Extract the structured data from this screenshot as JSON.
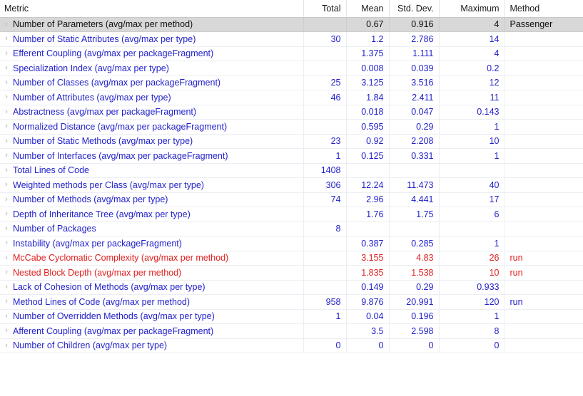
{
  "table": {
    "columns": [
      {
        "key": "metric",
        "label": "Metric",
        "align": "left"
      },
      {
        "key": "total",
        "label": "Total",
        "align": "right"
      },
      {
        "key": "mean",
        "label": "Mean",
        "align": "right"
      },
      {
        "key": "stddev",
        "label": "Std. Dev.",
        "align": "right"
      },
      {
        "key": "maximum",
        "label": "Maximum",
        "align": "right"
      },
      {
        "key": "method",
        "label": "Method",
        "align": "left"
      }
    ],
    "twisty_icon": "›",
    "colors": {
      "normal_row_text": "#2222cc",
      "warning_row_text": "#e02020",
      "selected_row_bg": "#d8d8d8",
      "selected_row_text": "#101010",
      "header_text": "#1a1a1a",
      "grid_line": "#eceef3"
    },
    "rows": [
      {
        "metric": "Number of Parameters (avg/max per method)",
        "total": "",
        "mean": "0.67",
        "stddev": "0.916",
        "maximum": "4",
        "method": "Passenger",
        "state": "selected"
      },
      {
        "metric": "Number of Static Attributes (avg/max per type)",
        "total": "30",
        "mean": "1.2",
        "stddev": "2.786",
        "maximum": "14",
        "method": "",
        "state": "normal"
      },
      {
        "metric": "Efferent Coupling (avg/max per packageFragment)",
        "total": "",
        "mean": "1.375",
        "stddev": "1.111",
        "maximum": "4",
        "method": "",
        "state": "normal"
      },
      {
        "metric": "Specialization Index (avg/max per type)",
        "total": "",
        "mean": "0.008",
        "stddev": "0.039",
        "maximum": "0.2",
        "method": "",
        "state": "normal"
      },
      {
        "metric": "Number of Classes (avg/max per packageFragment)",
        "total": "25",
        "mean": "3.125",
        "stddev": "3.516",
        "maximum": "12",
        "method": "",
        "state": "normal"
      },
      {
        "metric": "Number of Attributes (avg/max per type)",
        "total": "46",
        "mean": "1.84",
        "stddev": "2.411",
        "maximum": "11",
        "method": "",
        "state": "normal"
      },
      {
        "metric": "Abstractness (avg/max per packageFragment)",
        "total": "",
        "mean": "0.018",
        "stddev": "0.047",
        "maximum": "0.143",
        "method": "",
        "state": "normal"
      },
      {
        "metric": "Normalized Distance (avg/max per packageFragment)",
        "total": "",
        "mean": "0.595",
        "stddev": "0.29",
        "maximum": "1",
        "method": "",
        "state": "normal"
      },
      {
        "metric": "Number of Static Methods (avg/max per type)",
        "total": "23",
        "mean": "0.92",
        "stddev": "2.208",
        "maximum": "10",
        "method": "",
        "state": "normal"
      },
      {
        "metric": "Number of Interfaces (avg/max per packageFragment)",
        "total": "1",
        "mean": "0.125",
        "stddev": "0.331",
        "maximum": "1",
        "method": "",
        "state": "normal"
      },
      {
        "metric": "Total Lines of Code",
        "total": "1408",
        "mean": "",
        "stddev": "",
        "maximum": "",
        "method": "",
        "state": "normal"
      },
      {
        "metric": "Weighted methods per Class (avg/max per type)",
        "total": "306",
        "mean": "12.24",
        "stddev": "11.473",
        "maximum": "40",
        "method": "",
        "state": "normal"
      },
      {
        "metric": "Number of Methods (avg/max per type)",
        "total": "74",
        "mean": "2.96",
        "stddev": "4.441",
        "maximum": "17",
        "method": "",
        "state": "normal"
      },
      {
        "metric": "Depth of Inheritance Tree (avg/max per type)",
        "total": "",
        "mean": "1.76",
        "stddev": "1.75",
        "maximum": "6",
        "method": "",
        "state": "normal"
      },
      {
        "metric": "Number of Packages",
        "total": "8",
        "mean": "",
        "stddev": "",
        "maximum": "",
        "method": "",
        "state": "normal"
      },
      {
        "metric": "Instability (avg/max per packageFragment)",
        "total": "",
        "mean": "0.387",
        "stddev": "0.285",
        "maximum": "1",
        "method": "",
        "state": "normal"
      },
      {
        "metric": "McCabe Cyclomatic Complexity (avg/max per method)",
        "total": "",
        "mean": "3.155",
        "stddev": "4.83",
        "maximum": "26",
        "method": "run",
        "state": "warning"
      },
      {
        "metric": "Nested Block Depth (avg/max per method)",
        "total": "",
        "mean": "1.835",
        "stddev": "1.538",
        "maximum": "10",
        "method": "run",
        "state": "warning"
      },
      {
        "metric": "Lack of Cohesion of Methods (avg/max per type)",
        "total": "",
        "mean": "0.149",
        "stddev": "0.29",
        "maximum": "0.933",
        "method": "",
        "state": "normal"
      },
      {
        "metric": "Method Lines of Code (avg/max per method)",
        "total": "958",
        "mean": "9.876",
        "stddev": "20.991",
        "maximum": "120",
        "method": "run",
        "state": "normal"
      },
      {
        "metric": "Number of Overridden Methods (avg/max per type)",
        "total": "1",
        "mean": "0.04",
        "stddev": "0.196",
        "maximum": "1",
        "method": "",
        "state": "normal"
      },
      {
        "metric": "Afferent Coupling (avg/max per packageFragment)",
        "total": "",
        "mean": "3.5",
        "stddev": "2.598",
        "maximum": "8",
        "method": "",
        "state": "normal"
      },
      {
        "metric": "Number of Children (avg/max per type)",
        "total": "0",
        "mean": "0",
        "stddev": "0",
        "maximum": "0",
        "method": "",
        "state": "normal"
      }
    ]
  }
}
